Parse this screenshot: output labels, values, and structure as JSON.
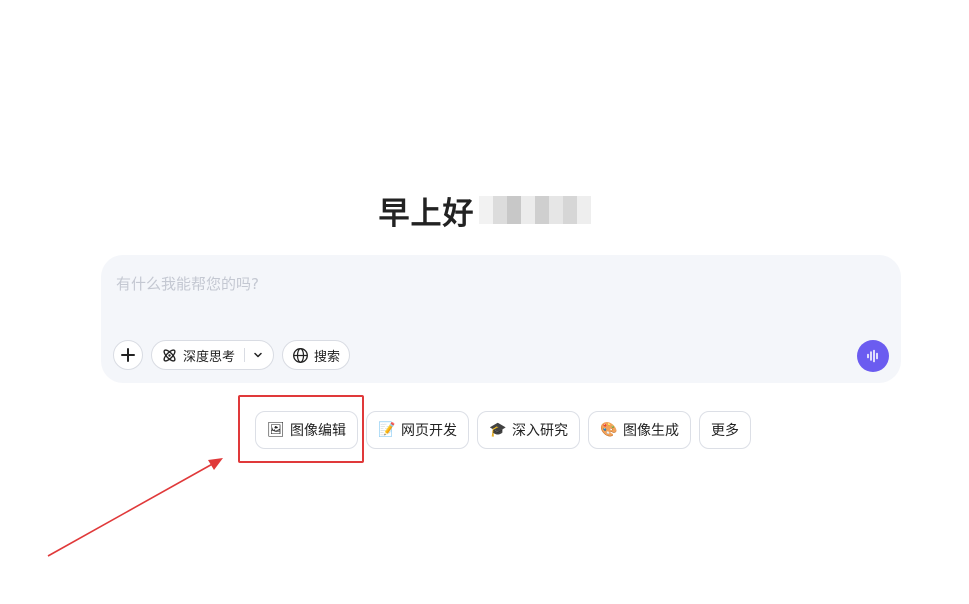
{
  "greeting": {
    "text": "早上好"
  },
  "composer": {
    "placeholder": "有什么我能帮您的吗?",
    "add_icon": "plus-icon",
    "deep_think": {
      "label": "深度思考",
      "icon": "atom-icon",
      "dropdown_icon": "chevron-down-icon"
    },
    "search": {
      "label": "搜索",
      "icon": "globe-icon"
    },
    "voice_icon": "voice-wave-icon",
    "accent_color": "#6b5cf0"
  },
  "chips": [
    {
      "emoji": "🖼",
      "label": "图像编辑",
      "icon": "image-edit-icon"
    },
    {
      "emoji": "📝",
      "label": "网页开发",
      "icon": "memo-icon"
    },
    {
      "emoji": "🎓",
      "label": "深入研究",
      "icon": "graduation-cap-icon"
    },
    {
      "emoji": "🎨",
      "label": "图像生成",
      "icon": "palette-icon"
    },
    {
      "emoji": "",
      "label": "更多",
      "icon": ""
    }
  ],
  "annotation": {
    "color": "#e0393a"
  }
}
